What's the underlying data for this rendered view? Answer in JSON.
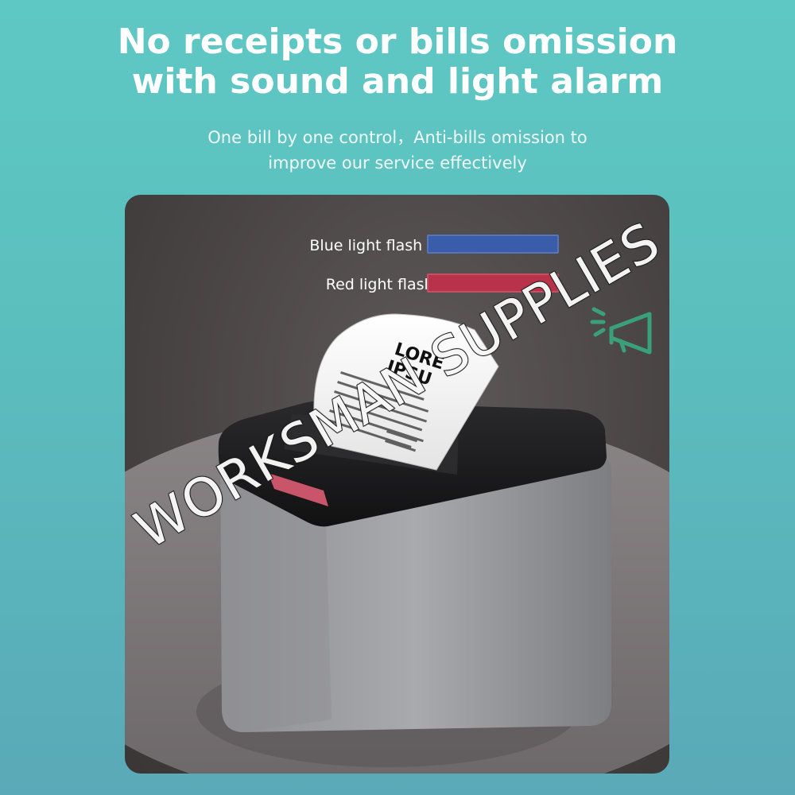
{
  "header": {
    "title_line1": "No receipts or bills omission",
    "title_line2": "with sound and light alarm",
    "subtitle_line1": "One bill by one control，Anti-bills omission to",
    "subtitle_line2": "improve our service effectively"
  },
  "legend": {
    "blue_label": "Blue light flash when power on：",
    "red_label": "Red light flash when printing：",
    "blue_color": "#3a5dab",
    "red_color": "#b8334a"
  },
  "receipt": {
    "logo_line1": "LORE",
    "logo_line2": "IPSU"
  },
  "icons": {
    "alarm": "loudspeaker-icon"
  },
  "watermark": "WORKSMAN SUPPLIES",
  "colors": {
    "background_teal": "#5ec8c4",
    "panel_dark": "#4a4545",
    "accent_green": "#3aa07a"
  }
}
